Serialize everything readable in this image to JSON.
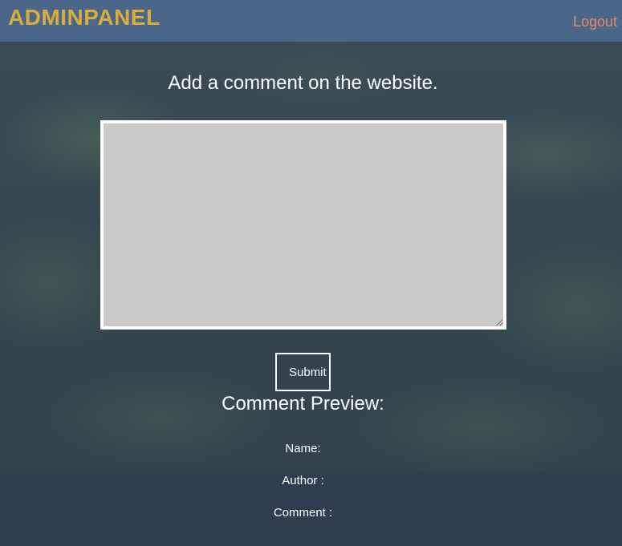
{
  "header": {
    "brand": "ADMINPANEL",
    "logout_label": "Logout"
  },
  "main": {
    "heading": "Add a comment on the website.",
    "comment_value": "",
    "submit_label": "Submit"
  },
  "preview": {
    "title": "Comment Preview:",
    "name_label": "Name:",
    "author_label": "Author :",
    "comment_label": "Comment :"
  },
  "colors": {
    "header_bg": "#4a6688",
    "brand": "#d9ad3c",
    "logout": "#e88a6c",
    "textarea_bg": "#c9c9c9"
  }
}
